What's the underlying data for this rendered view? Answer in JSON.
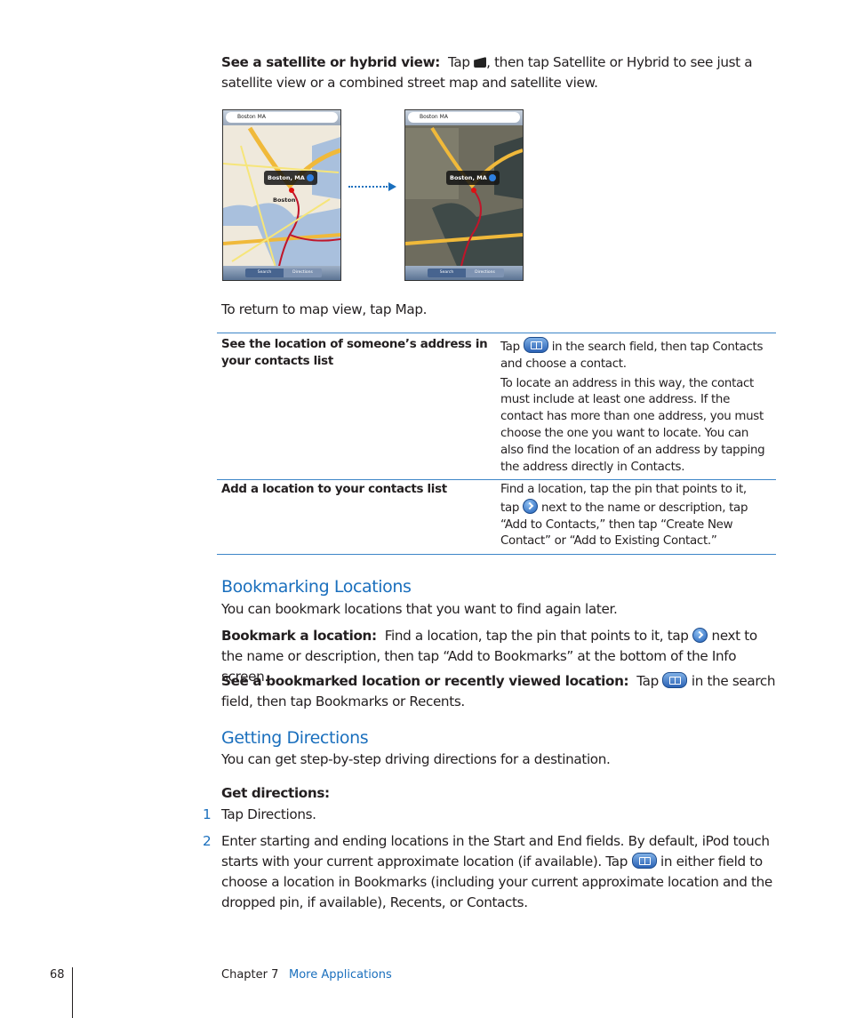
{
  "intro": {
    "lead": "See a satellite or hybrid view:",
    "text_before_icon": "Tap",
    "icon": "map-curl-icon",
    "text_after_icon": ", then tap Satellite or Hybrid to see just a satellite view or a combined street map and satellite view."
  },
  "figure": {
    "search_text": "Boston MA",
    "callout": "Boston, MA",
    "city_label": "Boston",
    "tab_search": "Search",
    "tab_directions": "Directions",
    "arrow_icon": "dotted-arrow-right",
    "colors": {
      "accent": "#1a6fbd",
      "rule": "#3d86c8"
    }
  },
  "return_text": "To return to map view, tap Map.",
  "table": {
    "rows": [
      {
        "task": "See the location of someone’s address in your contacts list",
        "desc_p1_before": "Tap",
        "desc_p1_icon": "bookmarks-icon",
        "desc_p1_after": "in the search field, then tap Contacts and choose a contact.",
        "desc_p2": "To locate an address in this way, the contact must include at least one address. If the contact has more than one address, you must choose the one you want to locate. You can also find the location of an address by tapping the address directly in Contacts."
      },
      {
        "task": "Add a location to your contacts list",
        "desc_p1_before": "Find a location, tap the pin that points to it, tap",
        "desc_p1_icon": "info-arrow-icon",
        "desc_p1_after": "next to the name or description, tap “Add to Contacts,” then tap “Create New Contact” or “Add to Existing Contact.”"
      }
    ]
  },
  "bookmarking": {
    "heading": "Bookmarking Locations",
    "intro": "You can bookmark locations that you want to find again later.",
    "item1_lead": "Bookmark a location:",
    "item1_before": "Find a location, tap the pin that points to it, tap",
    "item1_after": "next to the name or description, then tap “Add to Bookmarks” at the bottom of the Info screen.",
    "item2_lead": "See a bookmarked location or recently viewed location:",
    "item2_before": "Tap",
    "item2_after": "in the search field, then tap Bookmarks or Recents."
  },
  "directions": {
    "heading": "Getting Directions",
    "intro": "You can get step-by-step driving directions for a destination.",
    "subheading": "Get directions:",
    "steps": [
      {
        "num": "1",
        "text": "Tap Directions."
      },
      {
        "num": "2",
        "before": "Enter starting and ending locations in the Start and End fields. By default, iPod touch starts with your current approximate location (if available). Tap",
        "after": "in either field to choose a location in Bookmarks (including your current approximate location and the dropped pin, if available), Recents, or Contacts."
      }
    ]
  },
  "footer": {
    "page_number": "68",
    "chapter": "Chapter 7",
    "section": "More Applications"
  }
}
